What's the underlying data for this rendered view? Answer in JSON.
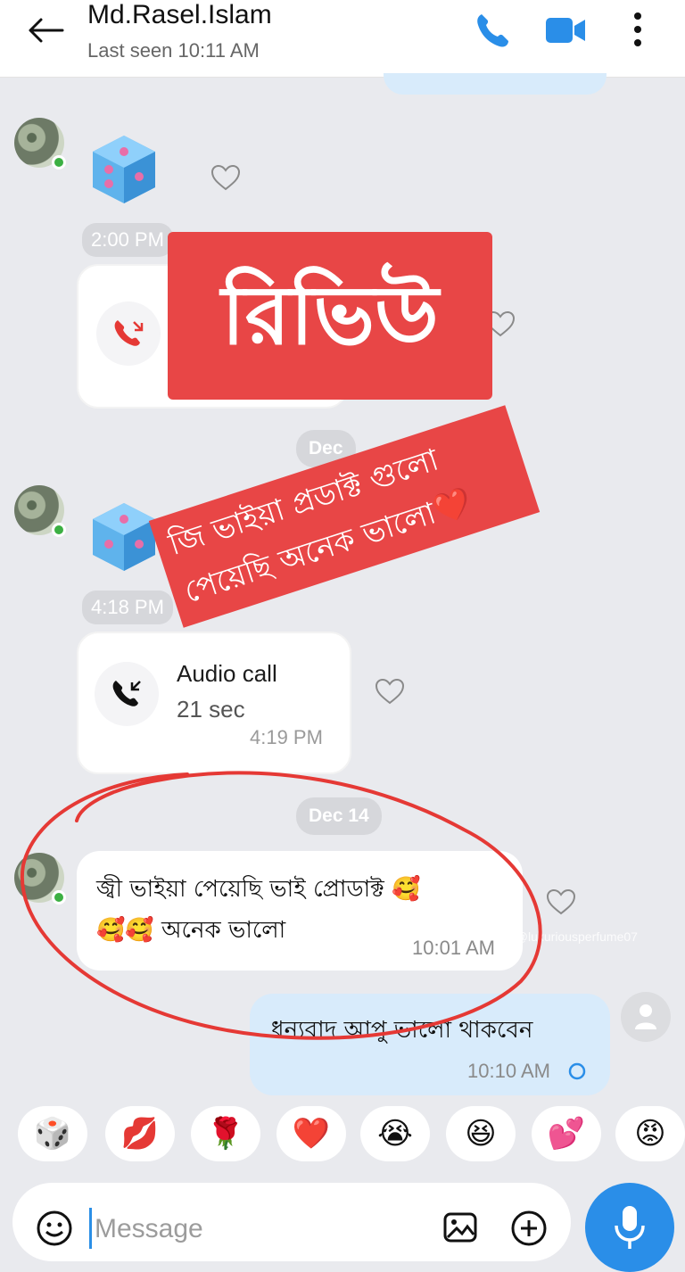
{
  "header": {
    "contact_name": "Md.Rasel.Islam",
    "last_seen": "Last seen 10:11 AM"
  },
  "messages": {
    "time_1": "2:00 PM",
    "time_2": "4:18 PM",
    "date_pill_partial": "Dec",
    "date_pill": "Dec 14",
    "audio_call": {
      "title": "Audio call",
      "duration": "21 sec",
      "time": "4:19 PM"
    },
    "incoming_text_line1": "জ্বী ভাইয়া পেয়েছি  ভাই প্রোডাক্ট 🥰",
    "incoming_text_line2": "🥰🥰 অনেক ভালো",
    "incoming_time": "10:01 AM",
    "outgoing_text": "ধন্যবাদ আপু ভালো থাকবেন",
    "outgoing_time": "10:10 AM"
  },
  "overlay": {
    "review_banner": "রিভিউ",
    "tilt_line1": "জি ভাইয়া প্রডাক্ট গুলো",
    "tilt_line2": "পেয়েছি অনেক ভালো❤️",
    "watermark": "ig @luxuriousperfume07"
  },
  "reactions": [
    "🎲",
    "💋",
    "🌹",
    "❤️",
    "😭",
    "😆",
    "💕",
    "😡"
  ],
  "composer": {
    "placeholder": "Message"
  },
  "colors": {
    "accent": "#2a8ee8",
    "outgoing_bubble": "#d8ebfb",
    "banner_red": "#e84646",
    "background": "#e9eaee"
  }
}
